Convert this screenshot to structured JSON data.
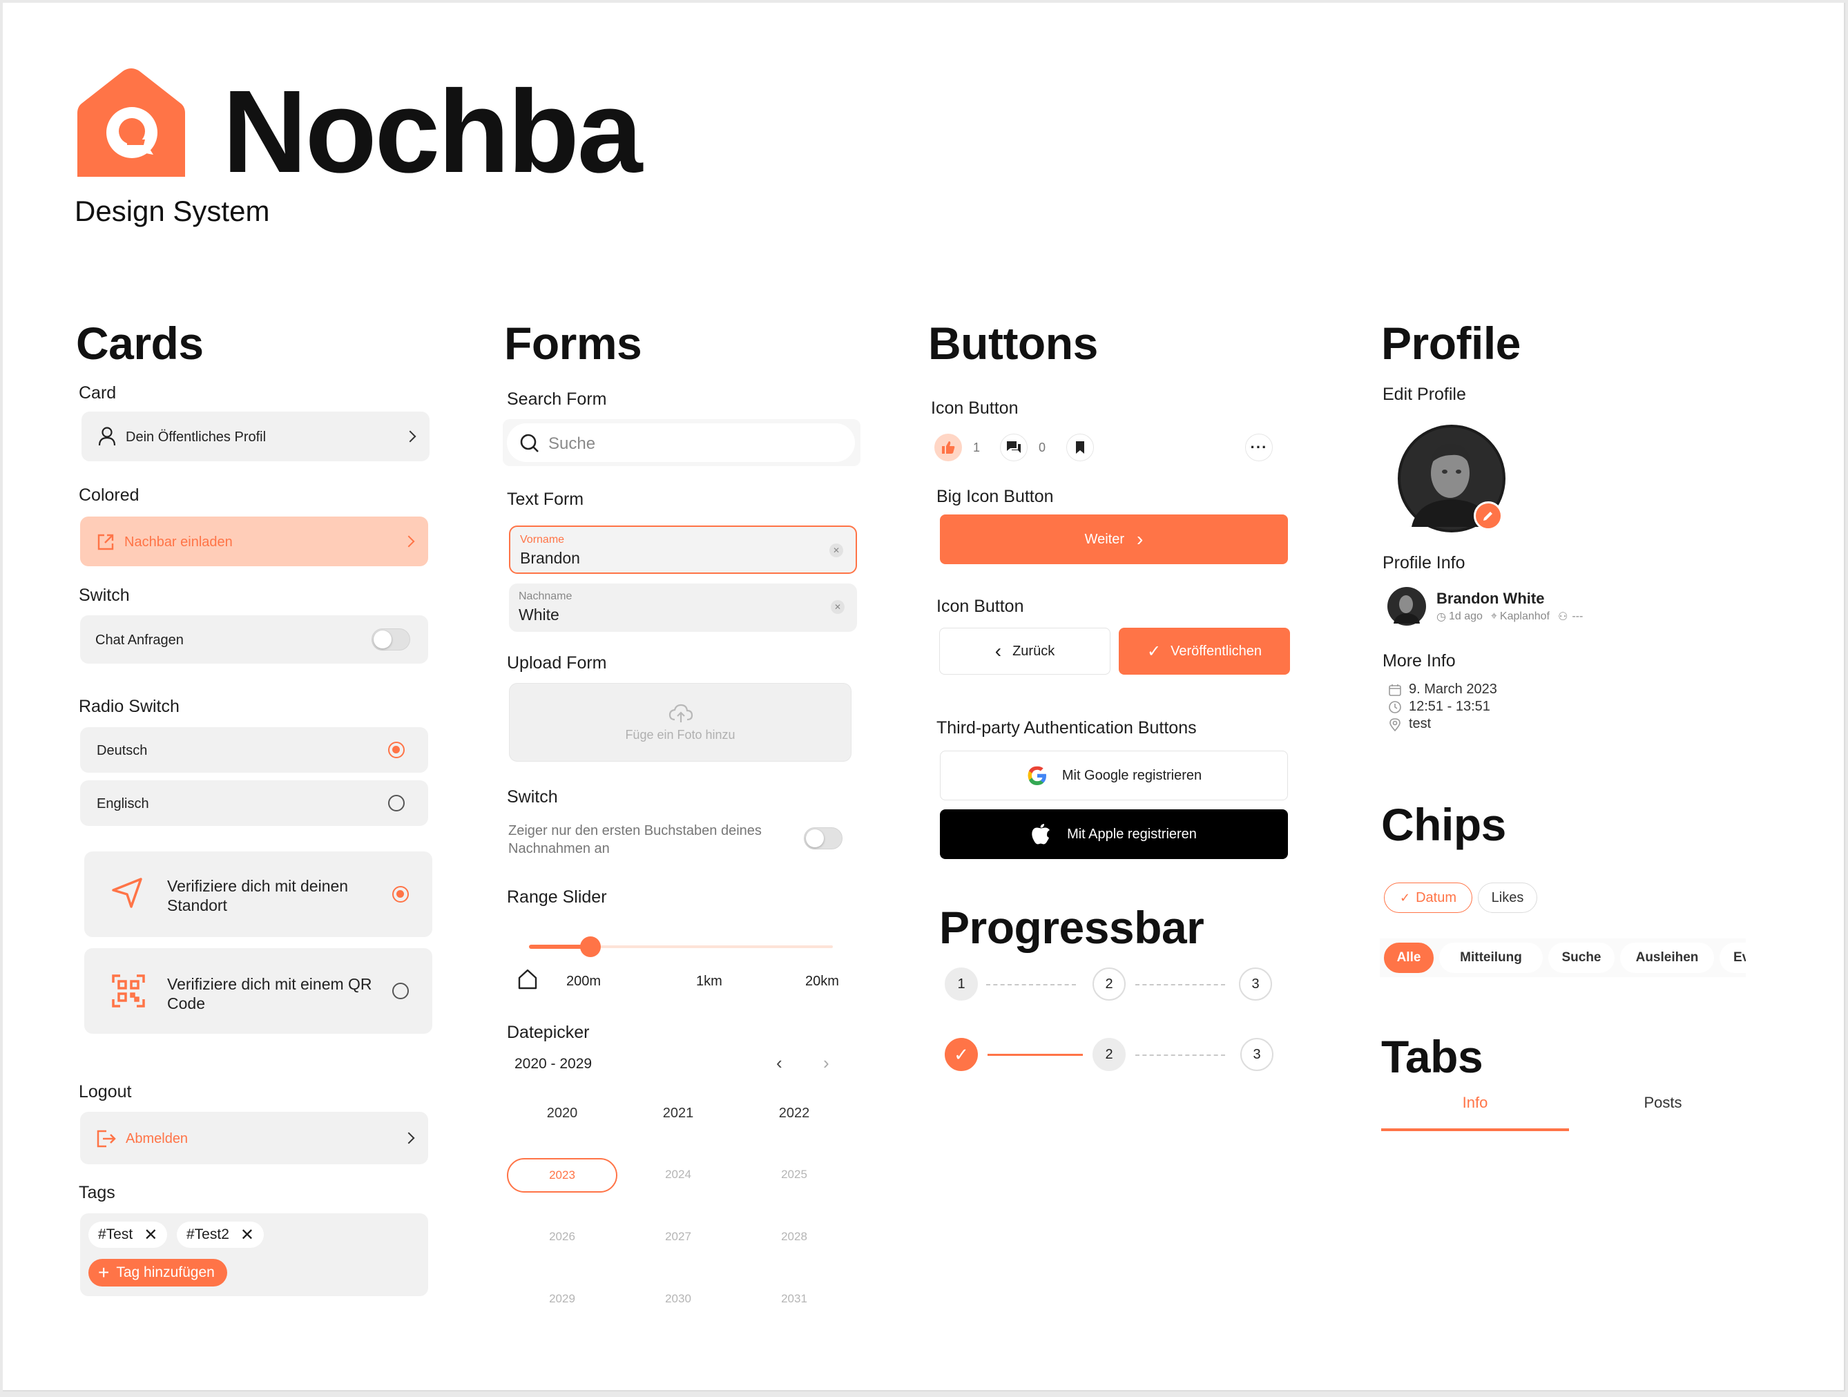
{
  "brand": {
    "name": "Nochba",
    "subtitle": "Design System",
    "accent": "#ff7447"
  },
  "cards": {
    "title": "Cards",
    "card_label": "Card",
    "card_item": "Dein Öffentliches Profil",
    "colored_label": "Colored",
    "colored_item": "Nachbar einladen",
    "switch_label": "Switch",
    "switch_item": "Chat Anfragen",
    "switch_on": false,
    "radio_label": "Radio Switch",
    "radio_options": [
      "Deutsch",
      "Englisch"
    ],
    "radio_selected": "Deutsch",
    "verify_location": "Verifiziere dich mit deinen Standort",
    "verify_qr": "Verifiziere dich mit einem QR Code",
    "logout_label": "Logout",
    "logout_item": "Abmelden",
    "tags_label": "Tags",
    "tags": [
      "#Test",
      "#Test2"
    ],
    "add_tag": "Tag hinzufügen"
  },
  "forms": {
    "title": "Forms",
    "search_label": "Search Form",
    "search_placeholder": "Suche",
    "text_label": "Text Form",
    "field1_label": "Vorname",
    "field1_value": "Brandon",
    "field2_label": "Nachname",
    "field2_value": "White",
    "upload_label": "Upload Form",
    "upload_text": "Füge ein Foto hinzu",
    "switch_label": "Switch",
    "switch_text": "Zeiger nur den ersten Buchstaben deines Nachnahmen an",
    "switch_on": false,
    "range_label": "Range Slider",
    "range_ticks": [
      "200m",
      "1km",
      "20km"
    ],
    "range_value_fraction": 0.2,
    "datepicker_label": "Datepicker",
    "datepicker_range": "2020 - 2029",
    "years": [
      "2020",
      "2021",
      "2022",
      "2023",
      "2024",
      "2025",
      "2026",
      "2027",
      "2028",
      "2029",
      "2030",
      "2031"
    ],
    "selected_year": "2023"
  },
  "buttons": {
    "title": "Buttons",
    "icon_button_label": "Icon Button",
    "like_count": "1",
    "comment_count": "0",
    "big_icon_label": "Big Icon Button",
    "weiter": "Weiter",
    "icon_button_label2": "Icon Button",
    "back": "Zurück",
    "publish": "Veröffentlichen",
    "third_party_label": "Third-party Authentication Buttons",
    "google": "Mit Google registrieren",
    "apple": "Mit Apple registrieren"
  },
  "progress": {
    "title": "Progressbar",
    "steps": [
      "1",
      "2",
      "3"
    ],
    "row2_steps": [
      "2",
      "3"
    ]
  },
  "profile": {
    "title": "Profile",
    "edit_label": "Edit Profile",
    "info_label": "Profile Info",
    "name": "Brandon White",
    "time": "1d ago",
    "location": "Kaplanhof",
    "extra": "---",
    "more_label": "More Info",
    "date": "9. March 2023",
    "time_range": "12:51 - 13:51",
    "place": "test"
  },
  "chips": {
    "title": "Chips",
    "row1": [
      "Datum",
      "Likes"
    ],
    "row2": [
      "Alle",
      "Mitteilung",
      "Suche",
      "Ausleihen",
      "Even"
    ]
  },
  "tabs": {
    "title": "Tabs",
    "items": [
      "Info",
      "Posts"
    ],
    "active": "Info"
  }
}
